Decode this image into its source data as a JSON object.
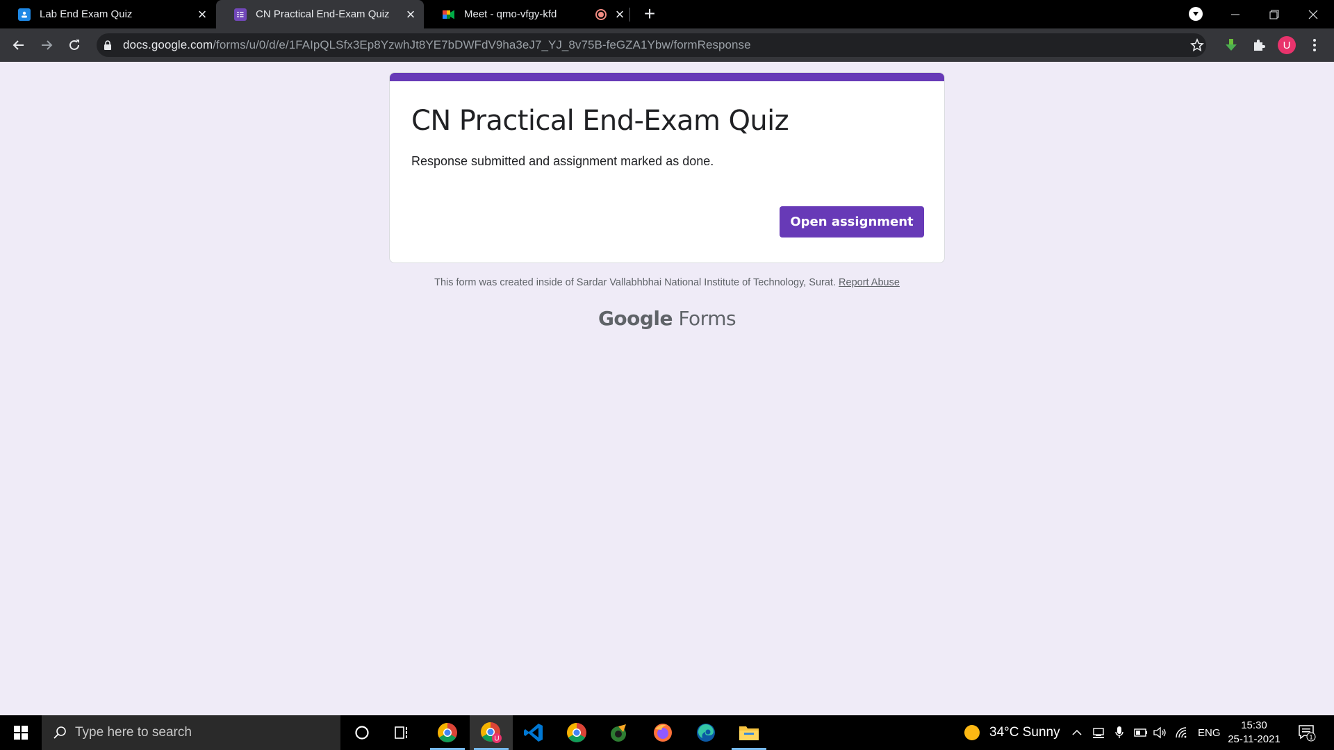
{
  "browser": {
    "tabs": [
      {
        "title": "Lab End Exam Quiz",
        "icon": "classroom-icon",
        "active": false
      },
      {
        "title": "CN Practical End-Exam Quiz",
        "icon": "forms-icon",
        "active": true
      },
      {
        "title": "Meet - qmo-vfgy-kfd",
        "icon": "meet-icon",
        "active": false
      }
    ],
    "url_host": "docs.google.com",
    "url_path": "/forms/u/0/d/e/1FAIpQLSfx3Ep8YzwhJt8YE7bDWFdV9ha3eJ7_YJ_8v75B-feGZA1Ybw/formResponse",
    "profile_initial": "U"
  },
  "form": {
    "title": "CN Practical End-Exam Quiz",
    "message": "Response submitted and assignment marked as done.",
    "button_label": "Open assignment",
    "footer_text": "This form was created inside of Sardar Vallabhbhai National Institute of Technology, Surat.",
    "report_abuse": "Report Abuse",
    "brand_google": "Google",
    "brand_forms": "Forms"
  },
  "taskbar": {
    "search_placeholder": "Type here to search",
    "weather": "34°C  Sunny",
    "language": "ENG",
    "time": "15:30",
    "date": "25-11-2021",
    "notification_count": "1",
    "apps": [
      "chrome-icon",
      "chrome-profile-icon",
      "vscode-icon",
      "chrome-icon",
      "unknown-app-icon",
      "firefox-icon",
      "edge-icon",
      "file-explorer-icon"
    ]
  },
  "colors": {
    "accent": "#673ab7",
    "page_bg": "#efebf7",
    "profile": "#e8336c"
  }
}
